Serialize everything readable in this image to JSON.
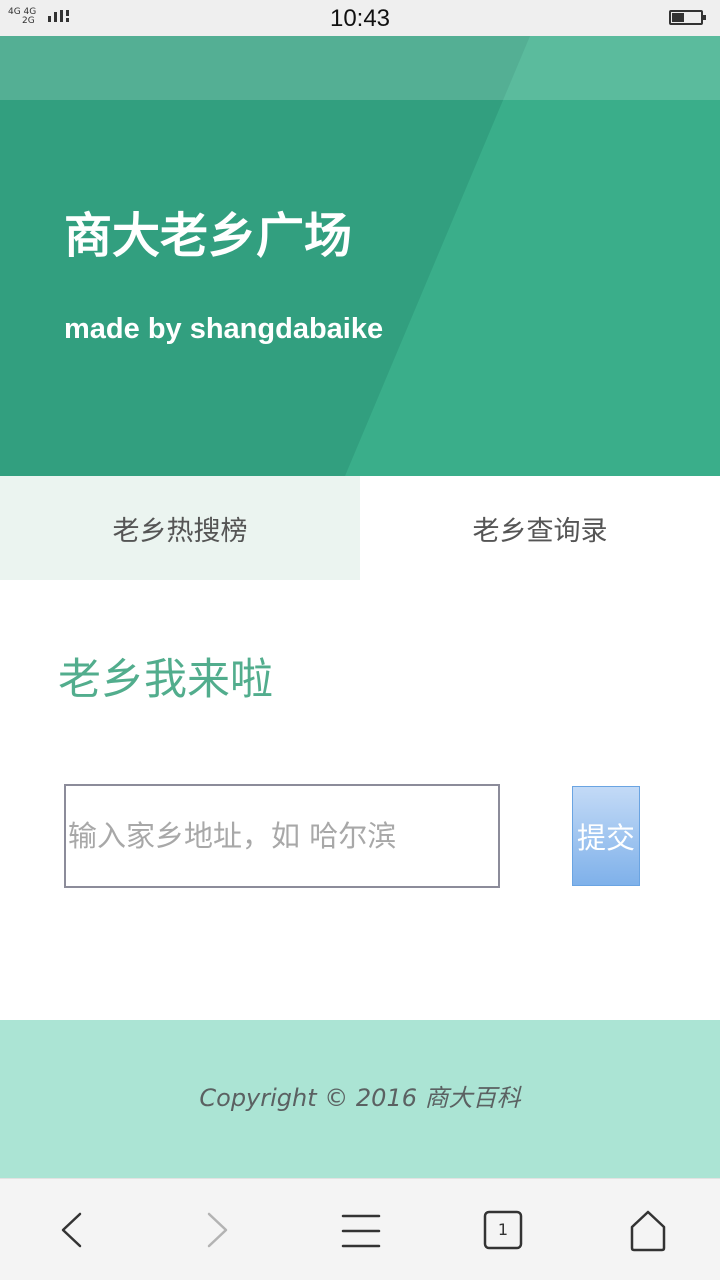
{
  "status_bar": {
    "time": "10:43",
    "network_top": "4G 4G",
    "network_bottom": "2G",
    "battery_icon": "battery-icon"
  },
  "hero": {
    "title": "商大老乡广场",
    "subtitle": "made by shangdabaike",
    "colors": {
      "base": "#3aae8a",
      "dark": "#329f7f",
      "light": "#5cbc9a"
    }
  },
  "tabs": [
    {
      "label": "老乡热搜榜",
      "active": true
    },
    {
      "label": "老乡查询录",
      "active": false
    }
  ],
  "main": {
    "heading": "老乡我来啦",
    "input": {
      "placeholder": "输入家乡地址，如 哈尔滨",
      "value": ""
    },
    "submit_label": "提交"
  },
  "footer": {
    "copyright": "Copyright © 2016 商大百科"
  },
  "browser_nav": {
    "icons": [
      "back-icon",
      "forward-icon",
      "menu-icon",
      "tabs-icon",
      "home-icon"
    ],
    "tab_count": "1"
  }
}
